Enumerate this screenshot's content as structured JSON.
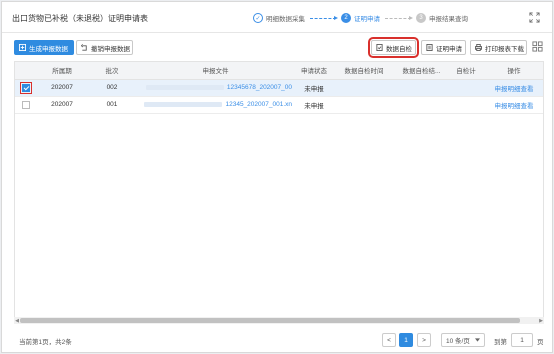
{
  "header": {
    "title": "出口货物已补税（未退税）证明申请表",
    "steps": [
      {
        "num": "✓",
        "label": "明细数据采集"
      },
      {
        "num": "2",
        "label": "证明申请"
      },
      {
        "num": "3",
        "label": "申报结果查询"
      }
    ]
  },
  "toolbar": {
    "generate_label": "生成申报数据",
    "revoke_label": "撤销申报数据",
    "self_check_label": "数据自检",
    "apply_label": "证明申请",
    "print_label": "打印报表下载"
  },
  "table": {
    "columns": [
      "所属期",
      "批次",
      "申报文件",
      "申请状态",
      "数据自检时间",
      "数据自检结...",
      "自检计",
      "操作"
    ],
    "rows": [
      {
        "period": "202007",
        "batch": "002",
        "file": "12345678_202007_00",
        "status": "未申报",
        "check_time": "",
        "check_result": "",
        "check_count": "",
        "action": "申报明细查看",
        "selected": true
      },
      {
        "period": "202007",
        "batch": "001",
        "file": "12345_202007_001.xn",
        "status": "未申报",
        "check_time": "",
        "check_result": "",
        "check_count": "",
        "action": "申报明细查看",
        "selected": false
      }
    ]
  },
  "footer": {
    "summary": "当前第1页，共2条",
    "prev": "<",
    "current_page": "1",
    "next": ">",
    "page_size": "10 条/页",
    "goto_label": "到第",
    "goto_value": "1",
    "page_suffix": "页"
  },
  "colors": {
    "accent": "#2f8be0",
    "highlight": "#d9302c"
  }
}
